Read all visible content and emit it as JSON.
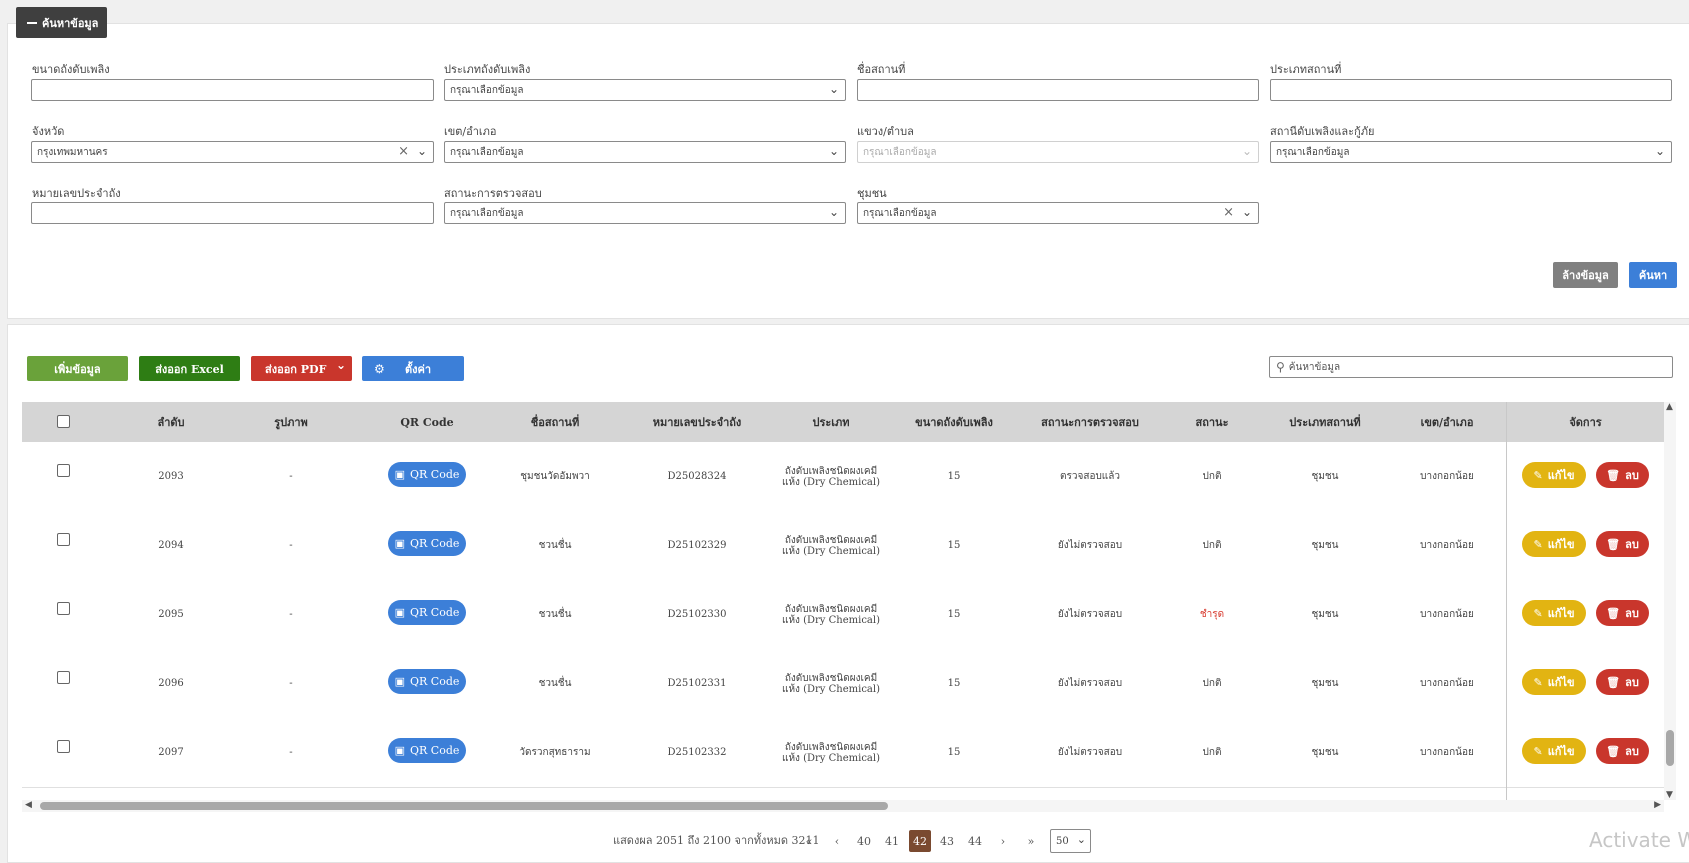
{
  "search_panel": {
    "toggle_label": "ค้นหาข้อมูล",
    "fields": {
      "tank_size": {
        "label": "ขนาดถังดับเพลิง",
        "value": ""
      },
      "tank_type": {
        "label": "ประเภทถังดับเพลิง",
        "value": "กรุณาเลือกข้อมูล"
      },
      "place_name": {
        "label": "ชื่อสถานที่",
        "value": ""
      },
      "place_type": {
        "label": "ประเภทสถานที่",
        "value": ""
      },
      "province": {
        "label": "จังหวัด",
        "value": "กรุงเทพมหานคร"
      },
      "district": {
        "label": "เขต/อำเภอ",
        "value": "กรุณาเลือกข้อมูล"
      },
      "subdistrict": {
        "label": "แขวง/ตำบล",
        "value": "กรุณาเลือกข้อมูล"
      },
      "fire_station": {
        "label": "สถานีดับเพลิงและกู้ภัย",
        "value": "กรุณาเลือกข้อมูล"
      },
      "tank_number": {
        "label": "หมายเลขประจำถัง",
        "value": ""
      },
      "inspection_status": {
        "label": "สถานะการตรวจสอบ",
        "value": "กรุณาเลือกข้อมูล"
      },
      "community": {
        "label": "ชุมชน",
        "value": "กรุณาเลือกข้อมูล"
      }
    },
    "clear_label": "ล้างข้อมูล",
    "search_label": "ค้นหา"
  },
  "toolbar": {
    "add_label": "เพิ่มข้อมูล",
    "excel_label": "ส่งออก Excel",
    "pdf_label": "ส่งออก PDF",
    "settings_label": "ตั้งค่า",
    "search_placeholder": "ค้นหาข้อมูล"
  },
  "table": {
    "columns": {
      "order": "ลำดับ",
      "image": "รูปภาพ",
      "qr": "QR Code",
      "place": "ชื่อสถานที่",
      "tank_no": "หมายเลขประจำถัง",
      "type": "ประเภท",
      "size": "ขนาดถังดับเพลิง",
      "inspection": "สถานะการตรวจสอบ",
      "status": "สถานะ",
      "place_type": "ประเภทสถานที่",
      "district": "เขต/อำเภอ",
      "actions": "จัดการ"
    },
    "qr_button_label": "QR Code",
    "edit_label": "แก้ไข",
    "delete_label": "ลบ",
    "rows": [
      {
        "order": "2093",
        "image": "-",
        "place": "ชุมชนวัดอัมพวา",
        "tank_no": "D25028324",
        "type": "ถังดับเพลิงชนิดผงเคมีแห้ง (Dry Chemical)",
        "size": "15",
        "inspection": "ตรวจสอบแล้ว",
        "status": "ปกติ",
        "status_color": "#444444",
        "place_type": "ชุมชน",
        "district": "บางกอกน้อย"
      },
      {
        "order": "2094",
        "image": "-",
        "place": "ชวนชื่น",
        "tank_no": "D25102329",
        "type": "ถังดับเพลิงชนิดผงเคมีแห้ง (Dry Chemical)",
        "size": "15",
        "inspection": "ยังไม่ตรวจสอบ",
        "status": "ปกติ",
        "status_color": "#444444",
        "place_type": "ชุมชน",
        "district": "บางกอกน้อย"
      },
      {
        "order": "2095",
        "image": "-",
        "place": "ชวนชื่น",
        "tank_no": "D25102330",
        "type": "ถังดับเพลิงชนิดผงเคมีแห้ง (Dry Chemical)",
        "size": "15",
        "inspection": "ยังไม่ตรวจสอบ",
        "status": "ชำรุด",
        "status_color": "#d83a2e",
        "place_type": "ชุมชน",
        "district": "บางกอกน้อย"
      },
      {
        "order": "2096",
        "image": "-",
        "place": "ชวนชื่น",
        "tank_no": "D25102331",
        "type": "ถังดับเพลิงชนิดผงเคมีแห้ง (Dry Chemical)",
        "size": "15",
        "inspection": "ยังไม่ตรวจสอบ",
        "status": "ปกติ",
        "status_color": "#444444",
        "place_type": "ชุมชน",
        "district": "บางกอกน้อย"
      },
      {
        "order": "2097",
        "image": "-",
        "place": "วัดรวกสุทธาราม",
        "tank_no": "D25102332",
        "type": "ถังดับเพลิงชนิดผงเคมีแห้ง (Dry Chemical)",
        "size": "15",
        "inspection": "ยังไม่ตรวจสอบ",
        "status": "ปกติ",
        "status_color": "#444444",
        "place_type": "ชุมชน",
        "district": "บางกอกน้อย"
      }
    ]
  },
  "pagination": {
    "summary": "แสดงผล 2051 ถึง 2100 จากทั้งหมด 3211",
    "first": "«",
    "prev": "‹",
    "pages": [
      "40",
      "41",
      "42",
      "43",
      "44"
    ],
    "current": "42",
    "next": "›",
    "last": "»",
    "page_size": "50"
  },
  "watermark": "Activate Wi",
  "icons": {
    "minus": "minus-icon",
    "chevron": "chevron-down-icon",
    "clear": "close-icon",
    "gear": "gear-icon",
    "search": "search-icon",
    "image": "image-icon",
    "pencil": "pencil-icon",
    "trash": "trash-icon"
  },
  "colors": {
    "primary": "#3c7fd8",
    "danger": "#c9362c",
    "warning": "#e2b412",
    "success": "#2e7d14",
    "add": "#6aa23a",
    "active_page": "#7a4a30"
  }
}
